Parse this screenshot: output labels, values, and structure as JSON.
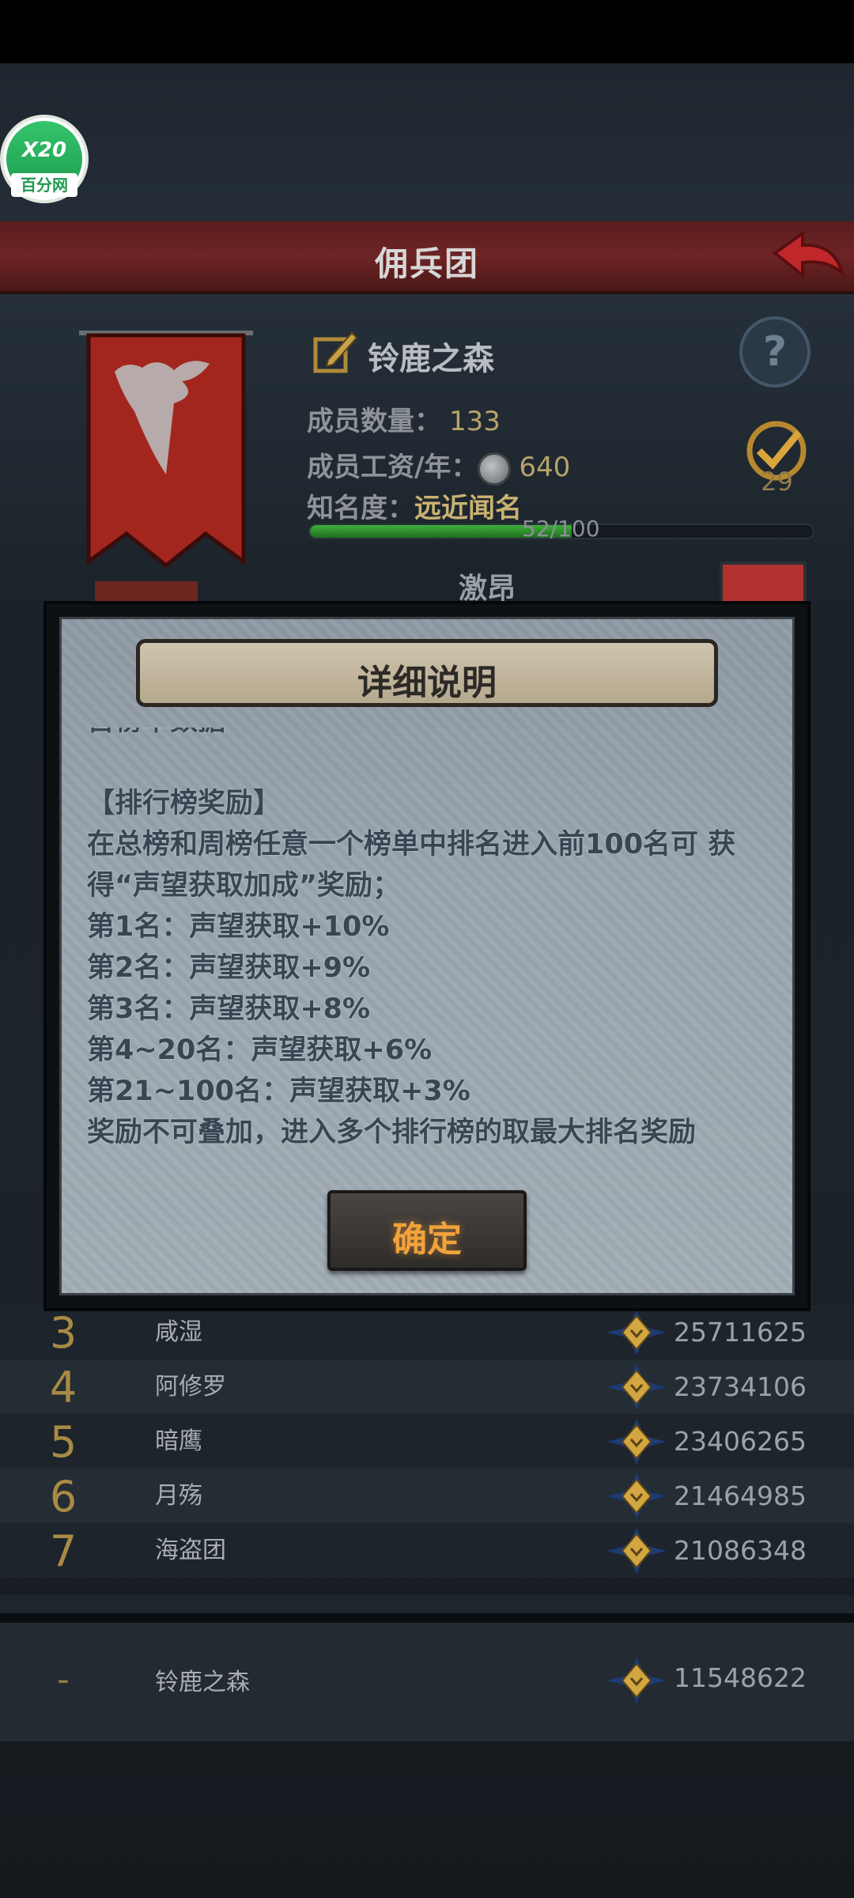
{
  "header": {
    "title": "佣兵团",
    "logo_top": "X20",
    "logo_bottom": "百分网"
  },
  "guild": {
    "name": "铃鹿之森",
    "members_label": "成员数量：",
    "members_value": "133",
    "salary_label": "成员工资/年：",
    "salary_value": "640",
    "fame_label": "知名度：",
    "fame_value": "远近闻名",
    "fame_progress_text": "52/100",
    "fame_progress": 0.52,
    "rank_badge_value": "29",
    "motto": "激昂"
  },
  "modal": {
    "title": "详细说明",
    "cut_line": "首榜单数据",
    "lines": [
      "【排行榜奖励】",
      "在总榜和周榜任意一个榜单中排名进入前100名可 获",
      "得“声望获取加成”奖励；",
      "第1名：声望获取+10%",
      "第2名：声望获取+9%",
      "第3名：声望获取+8%",
      "第4~20名：声望获取+6%",
      "第21~100名：声望获取+3%",
      "奖励不可叠加，进入多个排行榜的取最大排名奖励"
    ],
    "confirm_label": "确定"
  },
  "ranking": {
    "rows": [
      {
        "rank": "3",
        "name": "咸湿",
        "score": "25711625"
      },
      {
        "rank": "4",
        "name": "阿修罗",
        "score": "23734106"
      },
      {
        "rank": "5",
        "name": "暗鹰",
        "score": "23406265"
      },
      {
        "rank": "6",
        "name": "月殇",
        "score": "21464985"
      },
      {
        "rank": "7",
        "name": "海盗团",
        "score": "21086348"
      }
    ],
    "my_row": {
      "rank": "-",
      "name": "铃鹿之森",
      "score": "11548622"
    }
  },
  "colors": {
    "accent_gold": "#a98a45",
    "title_band": "#6e2424",
    "confirm_text": "#f1a23b"
  },
  "icons": [
    "back-arrow-icon",
    "edit-icon",
    "help-icon",
    "rank-badge-icon",
    "coin-icon",
    "emblem-icon"
  ]
}
